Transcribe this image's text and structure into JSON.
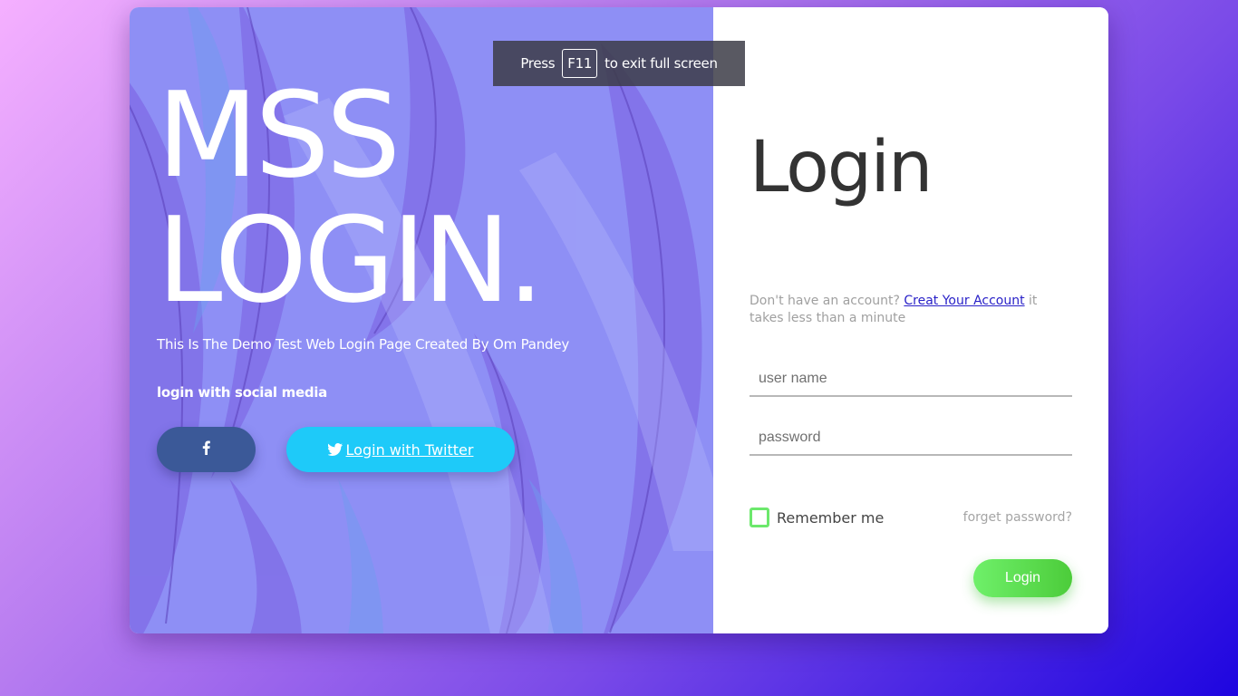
{
  "fullscreen_notice": {
    "prefix": "Press",
    "key": "F11",
    "suffix": "to exit full screen"
  },
  "brand": {
    "line1": "MSS",
    "line2": "LOGIN."
  },
  "tagline": "This Is The Demo Test Web Login Page Created By Om Pandey",
  "social": {
    "title": "login with social media",
    "facebook_icon": "facebook-icon",
    "twitter_icon": "twitter-icon",
    "twitter_label": "Login with Twitter"
  },
  "login": {
    "title": "Login",
    "signup_prefix": "Don't have an account?",
    "signup_link": "Creat Your Account",
    "signup_suffix": "it takes less than a minute",
    "username_placeholder": "user name",
    "password_placeholder": "password",
    "remember_label": "Remember me",
    "forgot_label": "forget password?",
    "submit_label": "Login"
  },
  "colors": {
    "panel_tint": "#8e8ff5",
    "facebook": "#3b5998",
    "twitter": "#1ecaf9",
    "login_button": "#5ddc4f",
    "checkbox_border": "#6ce86c",
    "link": "#2a22c8"
  }
}
